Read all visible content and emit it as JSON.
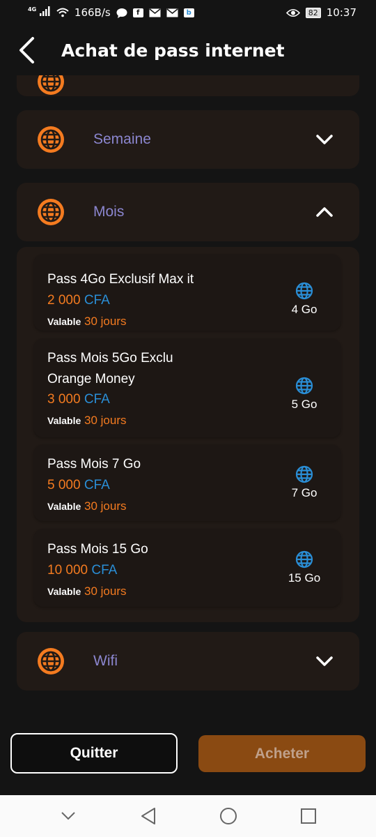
{
  "status_bar": {
    "network": "4G",
    "speed": "166B/s",
    "battery": "82",
    "time": "10:37"
  },
  "header": {
    "title": "Achat de pass internet"
  },
  "categories": [
    {
      "label": "Semaine",
      "expanded": false
    },
    {
      "label": "Mois",
      "expanded": true
    },
    {
      "label": "Wifi",
      "expanded": false
    }
  ],
  "offers": [
    {
      "name": "Pass 4Go Exclusif Max it",
      "price": "2 000",
      "currency": "CFA",
      "validity_label": "Valable",
      "validity": "30 jours",
      "data": "4 Go"
    },
    {
      "name": "Pass Mois 5Go Exclu Orange Money",
      "price": "3 000",
      "currency": "CFA",
      "validity_label": "Valable",
      "validity": "30 jours",
      "data": "5 Go"
    },
    {
      "name": "Pass Mois 7 Go",
      "price": "5 000",
      "currency": "CFA",
      "validity_label": "Valable",
      "validity": "30 jours",
      "data": "7 Go"
    },
    {
      "name": "Pass Mois 15 Go",
      "price": "10 000",
      "currency": "CFA",
      "validity_label": "Valable",
      "validity": "30 jours",
      "data": "15 Go"
    }
  ],
  "actions": {
    "quit_label": "Quitter",
    "buy_label": "Acheter"
  },
  "colors": {
    "accent_orange": "#f47b20",
    "currency_blue": "#2a8ed6",
    "category_label": "#8b86cf",
    "buy_button": "#8a4a12"
  }
}
